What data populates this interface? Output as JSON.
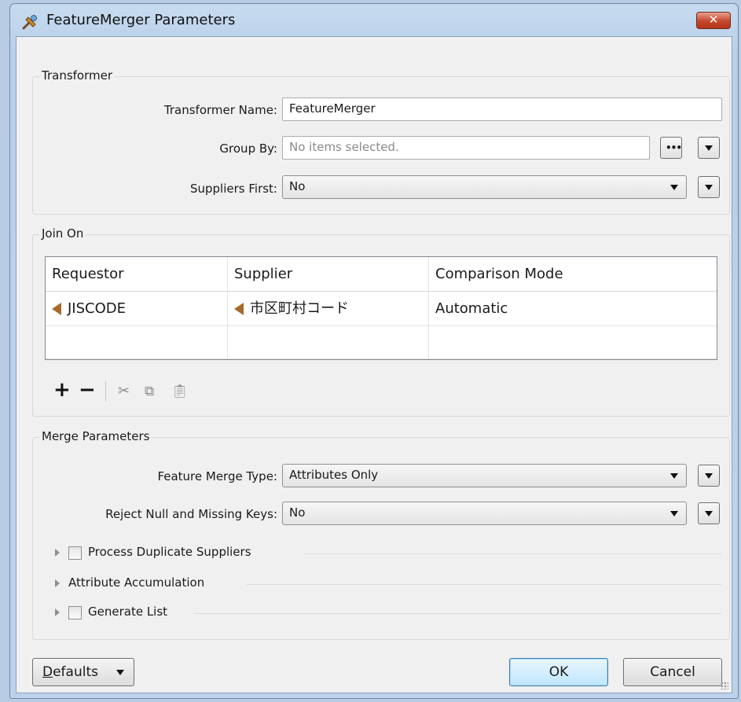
{
  "window": {
    "title": "FeatureMerger Parameters",
    "close_label": "✕"
  },
  "transformer": {
    "group_title": "Transformer",
    "name_label": "Transformer Name:",
    "name_value": "FeatureMerger",
    "group_by_label": "Group By:",
    "group_by_placeholder": "No items selected.",
    "suppliers_first_label": "Suppliers First:",
    "suppliers_first_value": "No"
  },
  "join_on": {
    "group_title": "Join On",
    "columns": [
      "Requestor",
      "Supplier",
      "Comparison Mode"
    ],
    "rows": [
      {
        "requestor": "JISCODE",
        "supplier": "市区町村コード",
        "mode": "Automatic"
      }
    ],
    "toolbar": [
      "add-icon",
      "remove-icon",
      "cut-icon",
      "copy-icon",
      "paste-icon"
    ]
  },
  "merge": {
    "group_title": "Merge Parameters",
    "merge_type_label": "Feature Merge Type:",
    "merge_type_value": "Attributes Only",
    "reject_label": "Reject Null and Missing Keys:",
    "reject_value": "No",
    "sections": [
      {
        "label": "Process Duplicate Suppliers",
        "has_checkbox": true,
        "checked": false
      },
      {
        "label": "Attribute Accumulation",
        "has_checkbox": false
      },
      {
        "label": "Generate List",
        "has_checkbox": true,
        "checked": false
      }
    ]
  },
  "footer": {
    "defaults_label": "Defaults",
    "defaults_accel": "D",
    "defaults_rest": "efaults",
    "ok_label": "OK",
    "cancel_label": "Cancel"
  },
  "colors": {
    "title_bg": "#c7dbef",
    "close_button": "#c6462d",
    "attribute_icon": "#a66a2a",
    "ok_border": "#3c7fb1"
  }
}
